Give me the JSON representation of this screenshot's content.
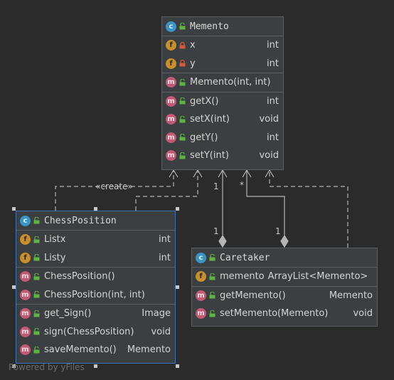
{
  "classes": {
    "memento": {
      "name": "Memento",
      "badge": "c",
      "fields": [
        {
          "badge": "f",
          "label": "x",
          "type": "int"
        },
        {
          "badge": "f",
          "label": "y",
          "type": "int"
        }
      ],
      "constructors": [
        {
          "badge": "m",
          "label": "Memento(int, int)",
          "type": ""
        }
      ],
      "methods": [
        {
          "badge": "m",
          "label": "getX()",
          "type": "int"
        },
        {
          "badge": "m",
          "label": "setX(int)",
          "type": "void"
        },
        {
          "badge": "m",
          "label": "getY()",
          "type": "int"
        },
        {
          "badge": "m",
          "label": "setY(int)",
          "type": "void"
        }
      ]
    },
    "chessposition": {
      "name": "ChessPosition",
      "badge": "c",
      "fields": [
        {
          "badge": "f",
          "label": "Listx",
          "type": "int"
        },
        {
          "badge": "f",
          "label": "Listy",
          "type": "int"
        }
      ],
      "constructors": [
        {
          "badge": "m",
          "label": "ChessPosition()",
          "type": ""
        },
        {
          "badge": "m",
          "label": "ChessPosition(int, int)",
          "type": ""
        }
      ],
      "methods": [
        {
          "badge": "m",
          "label": "get_Sign()",
          "type": "Image"
        },
        {
          "badge": "m",
          "label": "sign(ChessPosition)",
          "type": "void"
        },
        {
          "badge": "m",
          "label": "saveMemento()",
          "type": "Memento"
        }
      ]
    },
    "caretaker": {
      "name": "Caretaker",
      "badge": "c",
      "fields": [
        {
          "badge": "f",
          "label": "memento",
          "type": "ArrayList<Memento>"
        }
      ],
      "methods": [
        {
          "badge": "m",
          "label": "getMemento()",
          "type": "Memento"
        },
        {
          "badge": "m",
          "label": "setMemento(Memento)",
          "type": "void"
        }
      ]
    }
  },
  "edge_labels": {
    "create": "«create»",
    "mult_one_a": "1",
    "mult_star": "*",
    "mult_one_b": "1",
    "mult_one_c": "1"
  },
  "watermark": "Powered by yFiles",
  "colors": {
    "background": "#2b2b2b",
    "node_fill": "#3c3f41",
    "selection": "#3d72b8",
    "edge": "#b4b4b4"
  }
}
